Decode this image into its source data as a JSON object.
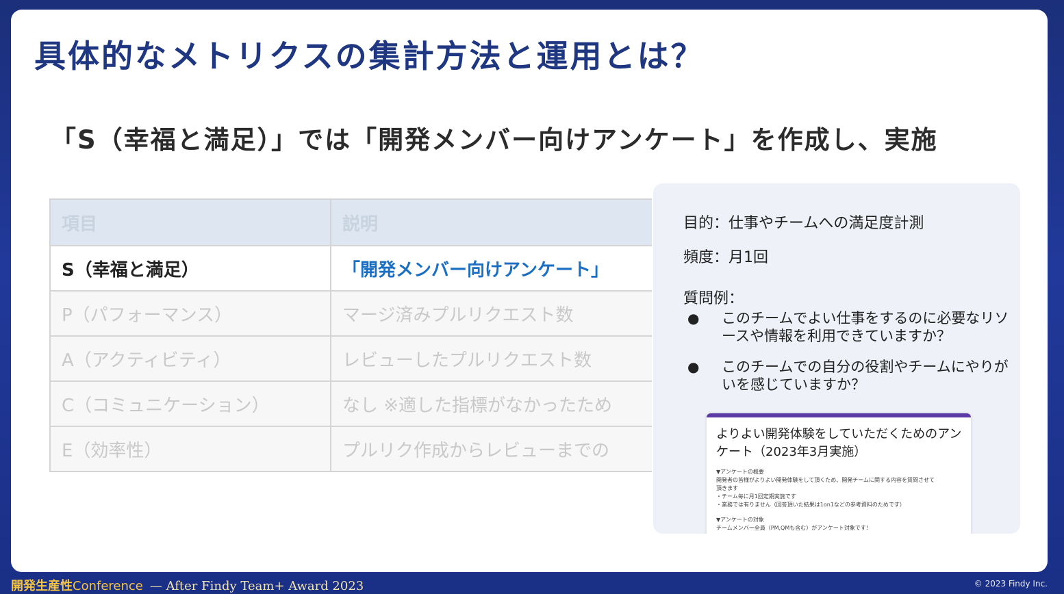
{
  "slide": {
    "title": "具体的なメトリクスの集計方法と運用とは？",
    "subtitle": "「S（幸福と満足）」では「開発メンバー向けアンケート」を作成し、実施"
  },
  "table": {
    "headers": [
      "項目",
      "説明"
    ],
    "rows": [
      {
        "item": "S（幸福と満足）",
        "desc": "「開発メンバー向けアンケート」"
      },
      {
        "item": "P（パフォーマンス）",
        "desc": "マージ済みプルリクエスト数"
      },
      {
        "item": "A（アクティビティ）",
        "desc": "レビューしたプルリクエスト数"
      },
      {
        "item": "C（コミュニケーション）",
        "desc": "なし ※適した指標がなかったため"
      },
      {
        "item": "E（効率性）",
        "desc": "プルリク作成からレビューまでの"
      }
    ]
  },
  "panel": {
    "purpose": "目的：仕事やチームへの満足度計測",
    "frequency": "頻度：月1回",
    "examples_label": "質問例：",
    "examples": [
      "このチームでよい仕事をするのに必要なリソースや情報を利用できていますか？",
      "このチームでの自分の役割やチームにやりがいを感じていますか？"
    ],
    "survey_title": "よりよい開発体験をしていただくためのアンケート（2023年3月実施）",
    "survey_lines": [
      "▼アンケートの概要",
      "開発者の皆様がよりよい開発体験をして頂くため、開発チームに関する内容を質問させて",
      "頂きます",
      "・チーム毎に月1回定期実施です",
      "・業務では有りません（回答頂いた結果は1on1などの参考資料のためです）",
      "▼アンケートの対象",
      "チームメンバー全員（PM,QMも含む）がアンケート対象です！"
    ]
  },
  "footer": {
    "brand": "開発生産性",
    "conference": "Conference",
    "after": "— After Findy Team+ Award 2023",
    "copyright": "© 2023 Findy Inc."
  }
}
